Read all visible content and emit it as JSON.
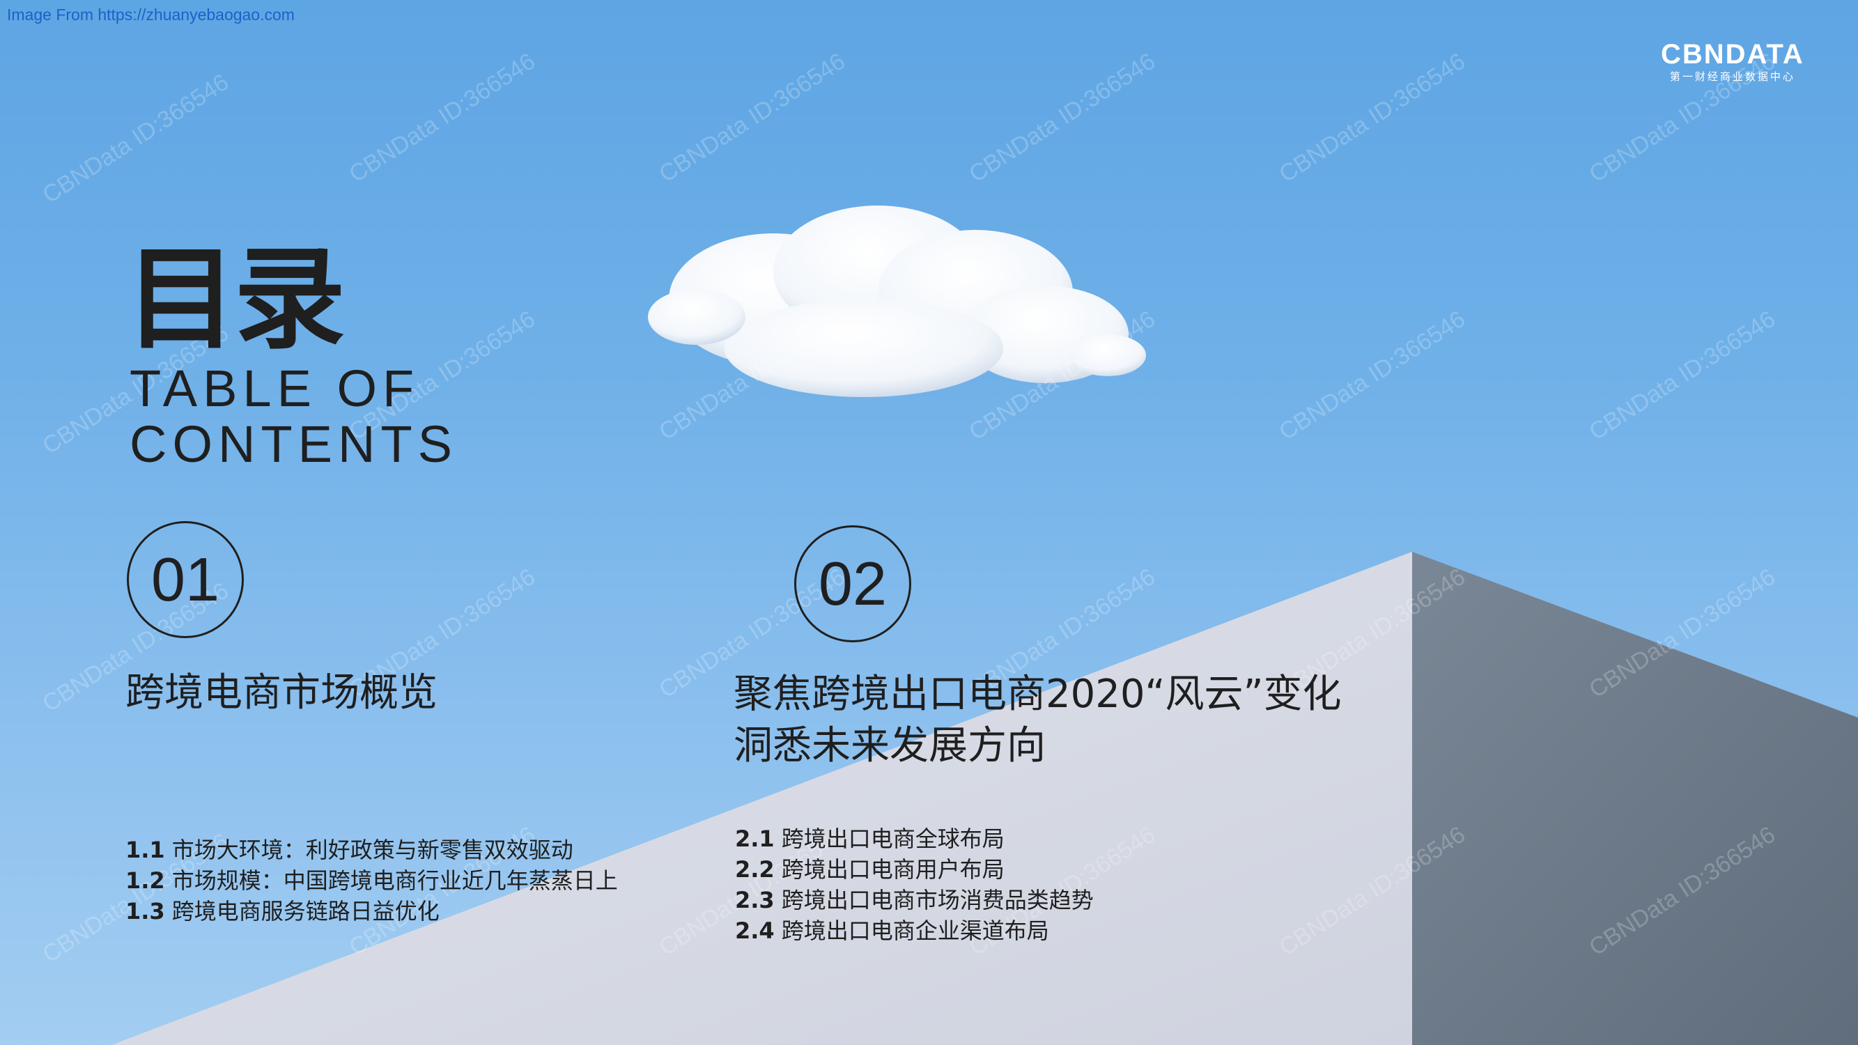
{
  "source_link": "Image From https://zhuanyebaogao.com",
  "logo": {
    "word": "CBNDATA",
    "sub": "第一财经商业数据中心"
  },
  "watermark": "CBNData ID:366546",
  "title_cn": "目录",
  "title_en_line1": "TABLE OF",
  "title_en_line2": "CONTENTS",
  "sections": [
    {
      "number": "01",
      "title_line1": "跨境电商市场概览",
      "items": [
        {
          "num": "1.1",
          "text": "市场大环境：利好政策与新零售双效驱动"
        },
        {
          "num": "1.2",
          "text": "市场规模：中国跨境电商行业近几年蒸蒸日上"
        },
        {
          "num": "1.3",
          "text": "跨境电商服务链路日益优化"
        }
      ]
    },
    {
      "number": "02",
      "title_line1": "聚焦跨境出口电商2020“风云”变化",
      "title_line2": "洞悉未来发展方向",
      "items": [
        {
          "num": "2.1",
          "text": "跨境出口电商全球布局"
        },
        {
          "num": "2.2",
          "text": "跨境出口电商用户布局"
        },
        {
          "num": "2.3",
          "text": "跨境出口电商市场消费品类趋势"
        },
        {
          "num": "2.4",
          "text": "跨境出口电商企业渠道布局"
        }
      ]
    }
  ],
  "colors": {
    "sky": "#6fb0e8",
    "wall_light": "#d4d8e3",
    "wall_dark": "#6b7a8a",
    "text": "#1f1f1f",
    "link": "#1a63c9"
  }
}
